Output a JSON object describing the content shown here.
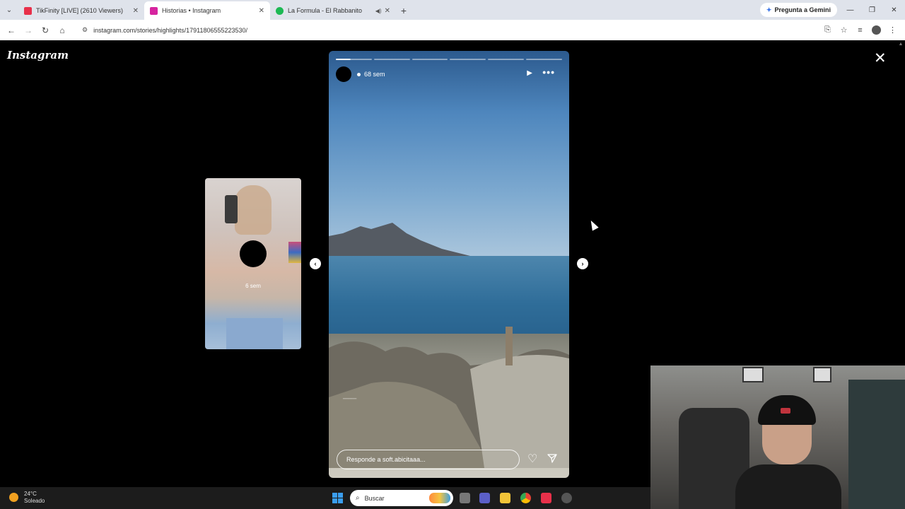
{
  "browser": {
    "tabs": [
      {
        "title": "TikFinity [LIVE] (2610 Viewers)",
        "active": false,
        "favicon_color": "#e8304a"
      },
      {
        "title": "Historias • Instagram",
        "active": true,
        "favicon_color": "#d6249f"
      },
      {
        "title": "La Formula - El Rabbanito",
        "active": false,
        "favicon_color": "#1db954"
      }
    ],
    "gemini_label": "Pregunta a Gemini",
    "url": "instagram.com/stories/highlights/17911806555223530/"
  },
  "instagram": {
    "logo": "Instagram",
    "preview": {
      "time": "6 sem"
    },
    "story": {
      "time": "68 sem",
      "segments": 6,
      "progress": 0.4,
      "reply_placeholder": "Responde a soft.abicitaaa..."
    }
  },
  "taskbar": {
    "temperature": "24°C",
    "weather": "Soleado",
    "search_placeholder": "Buscar"
  },
  "colors": {
    "accent": "#3a9ef0",
    "background": "#000000"
  }
}
